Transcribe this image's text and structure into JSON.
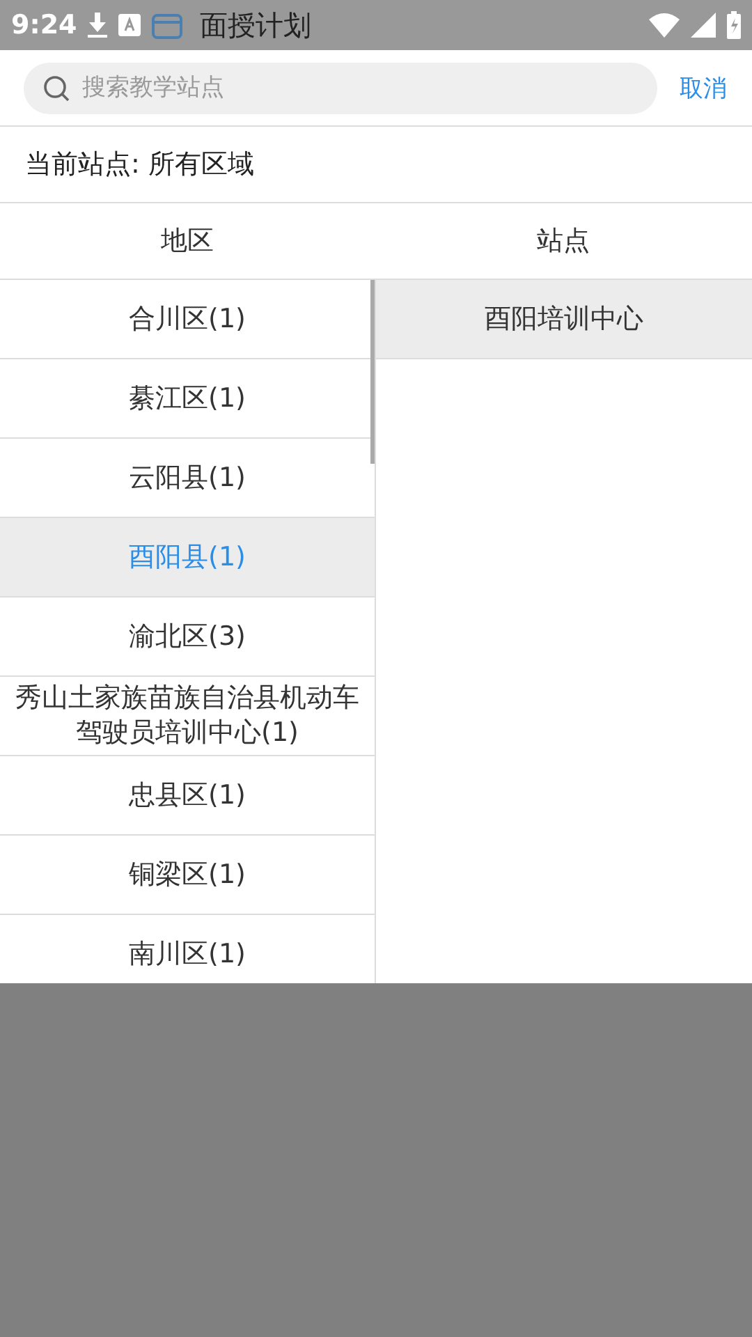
{
  "status_bar": {
    "time": "9:24"
  },
  "app_title": "面授计划",
  "search": {
    "placeholder": "搜索教学站点",
    "cancel": "取消"
  },
  "current_station": "当前站点: 所有区域",
  "columns": [
    "地区",
    "站点"
  ],
  "regions": [
    {
      "label": "合川区(1)",
      "selected": false
    },
    {
      "label": "綦江区(1)",
      "selected": false
    },
    {
      "label": "云阳县(1)",
      "selected": false
    },
    {
      "label": "酉阳县(1)",
      "selected": true
    },
    {
      "label": "渝北区(3)",
      "selected": false
    },
    {
      "label": "秀山土家族苗族自治县机动车驾驶员培训中心(1)",
      "selected": false
    },
    {
      "label": "忠县区(1)",
      "selected": false
    },
    {
      "label": "铜梁区(1)",
      "selected": false
    },
    {
      "label": "南川区(1)",
      "selected": false
    }
  ],
  "stations": [
    {
      "label": "酉阳培训中心",
      "selected": true
    }
  ]
}
